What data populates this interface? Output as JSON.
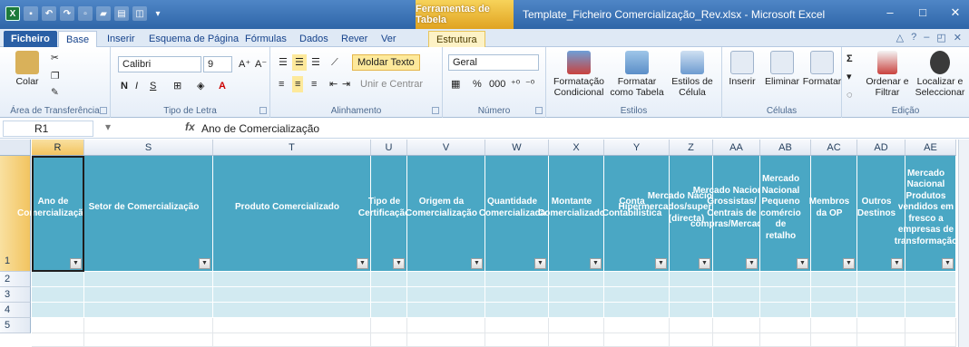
{
  "title_bar": {
    "context_tab_title": "Ferramentas de Tabela",
    "window_title": "Template_Ficheiro Comercialização_Rev.xlsx - Microsoft Excel",
    "minimize": "–",
    "maximize": "□",
    "close": "✕"
  },
  "ribbon_tabs": [
    "Ficheiro",
    "Base",
    "Inserir",
    "Esquema de Página",
    "Fórmulas",
    "Dados",
    "Rever",
    "Ver",
    "Estrutura"
  ],
  "ribbon": {
    "clipboard": {
      "paste": "Colar",
      "label": "Área de Transferência"
    },
    "font": {
      "name": "Calibri",
      "size": "9",
      "bold": "N",
      "italic": "I",
      "underline": "S",
      "label": "Tipo de Letra"
    },
    "alignment": {
      "wrap_text": "Moldar Texto",
      "merge_center": "Unir e Centrar",
      "label": "Alinhamento"
    },
    "number": {
      "format": "Geral",
      "percent": "%",
      "thousands": "000",
      "label": "Número"
    },
    "styles": {
      "conditional": "Formatação Condicional",
      "as_table": "Formatar como Tabela",
      "cell_styles": "Estilos de Célula",
      "label": "Estilos"
    },
    "cells": {
      "insert": "Inserir",
      "delete": "Eliminar",
      "format": "Formatar",
      "label": "Células"
    },
    "editing": {
      "sort_filter": "Ordenar e Filtrar",
      "find_select": "Localizar e Seleccionar",
      "label": "Edição"
    }
  },
  "formula_bar": {
    "name_box": "R1",
    "fx": "fx",
    "content": "Ano de Comercialização"
  },
  "columns": [
    "R",
    "S",
    "T",
    "U",
    "V",
    "W",
    "X",
    "Y",
    "Z",
    "AA",
    "AB",
    "AC",
    "AD",
    "AE"
  ],
  "rows": [
    "1",
    "2",
    "3",
    "4",
    "5"
  ],
  "headers": [
    "Ano de Comercialização",
    "Setor de Comercialização",
    "Produto Comercializado",
    "Tipo de Certificação",
    "Origem da Comercialização",
    "Quantidade Comercializada",
    "Montante Comercializado",
    "Conta Contabilística",
    "Mercado Nacional Hipermercados/supermercados (directa)",
    "Mercado Nacional Grossistas/ Centrais de compras/Mercados",
    "Mercado Nacional Pequeno comércio de retalho",
    "Membros da OP",
    "Outros Destinos",
    "Mercado Nacional Produtos vendidos em fresco a empresas de transformação"
  ],
  "colors": {
    "header_fill": "#4aa7c4",
    "band_fill": "#d2eaf1",
    "title_bar": "#2f66a8",
    "context_tab": "#e0a321"
  }
}
